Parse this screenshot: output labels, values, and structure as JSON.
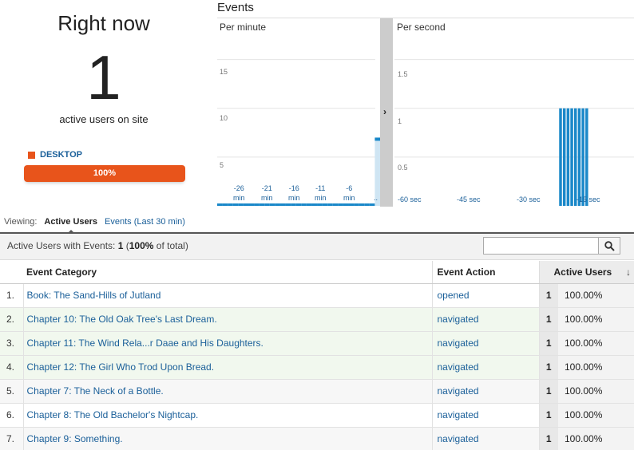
{
  "right_now": {
    "title": "Right now",
    "count": "1",
    "subtitle": "active users on site",
    "device_label": "DESKTOP",
    "device_percent_text": "100%",
    "device_fraction": 1.0,
    "device_color": "#e8541b"
  },
  "events": {
    "title": "Events",
    "per_minute": {
      "label": "Per minute",
      "y_ticks": [
        "15",
        "10",
        "5"
      ],
      "x_ticks": [
        {
          "top": "-26",
          "bottom": "min"
        },
        {
          "top": "-21",
          "bottom": "min"
        },
        {
          "top": "-16",
          "bottom": "min"
        },
        {
          "top": "-11",
          "bottom": "min"
        },
        {
          "top": "-6",
          "bottom": "min"
        }
      ],
      "partial_tick": ".."
    },
    "divider_arrow": "›",
    "per_second": {
      "label": "Per second",
      "y_ticks": [
        "1.5",
        "1",
        "0.5"
      ],
      "x_ticks": [
        "-60 sec",
        "-45 sec",
        "-30 sec",
        "-15 sec"
      ]
    }
  },
  "chart_data": [
    {
      "type": "bar",
      "title": "Per minute",
      "x_unit": "min",
      "x": [
        -30,
        -29,
        -28,
        -27,
        -26,
        -25,
        -24,
        -23,
        -22,
        -21,
        -20,
        -19,
        -18,
        -17,
        -16,
        -15,
        -14,
        -13,
        -12,
        -11,
        -10,
        -9,
        -8,
        -7,
        -6,
        -5,
        -4,
        -3,
        -2,
        -1,
        0
      ],
      "values": [
        0,
        0,
        0,
        0,
        0,
        0,
        0,
        0,
        0,
        0,
        0,
        0,
        0,
        0,
        0,
        0,
        0,
        0,
        0,
        0,
        0,
        0,
        0,
        0,
        0,
        0,
        0,
        0,
        0,
        0,
        7
      ],
      "yticks": [
        5,
        10,
        15
      ],
      "ylim": [
        0,
        18
      ]
    },
    {
      "type": "bar",
      "title": "Per second",
      "x_unit": "sec",
      "x": [
        -20,
        -19,
        -18,
        -17,
        -16,
        -15,
        -14,
        -13
      ],
      "values": [
        1,
        1,
        1,
        1,
        1,
        1,
        1,
        1
      ],
      "yticks": [
        0.5,
        1,
        1.5
      ],
      "ylim": [
        0,
        1.8
      ]
    }
  ],
  "viewing": {
    "label": "Viewing:",
    "active_tab": "Active Users",
    "other_tab": "Events (Last 30 min)"
  },
  "summary": {
    "label": "Active Users with Events:",
    "count": "1",
    "open_paren": "(",
    "percent": "100%",
    "rest": "of total)"
  },
  "search": {
    "placeholder": ""
  },
  "table": {
    "headers": {
      "category": "Event Category",
      "action": "Event Action",
      "users": "Active Users",
      "sort": "↓"
    },
    "rows": [
      {
        "num": "1.",
        "category": "Book: The Sand-Hills of Jutland",
        "action": "opened",
        "users": "1",
        "percent": "100.00%"
      },
      {
        "num": "2.",
        "category": "Chapter 10: The Old Oak Tree's Last Dream.",
        "action": "navigated",
        "users": "1",
        "percent": "100.00%"
      },
      {
        "num": "3.",
        "category": "Chapter 11: The Wind Rela...r Daae and His Daughters.",
        "action": "navigated",
        "users": "1",
        "percent": "100.00%"
      },
      {
        "num": "4.",
        "category": "Chapter 12: The Girl Who Trod Upon Bread.",
        "action": "navigated",
        "users": "1",
        "percent": "100.00%"
      },
      {
        "num": "5.",
        "category": "Chapter 7: The Neck of a Bottle.",
        "action": "navigated",
        "users": "1",
        "percent": "100.00%"
      },
      {
        "num": "6.",
        "category": "Chapter 8: The Old Bachelor's Nightcap.",
        "action": "navigated",
        "users": "1",
        "percent": "100.00%"
      },
      {
        "num": "7.",
        "category": "Chapter 9: Something.",
        "action": "navigated",
        "users": "1",
        "percent": "100.00%"
      }
    ]
  },
  "colors": {
    "accent_blue": "#1a5f99",
    "bar_blue": "#1a88c9",
    "bar_light_blue": "#cfe5f3",
    "desktop_orange": "#e8541b"
  }
}
